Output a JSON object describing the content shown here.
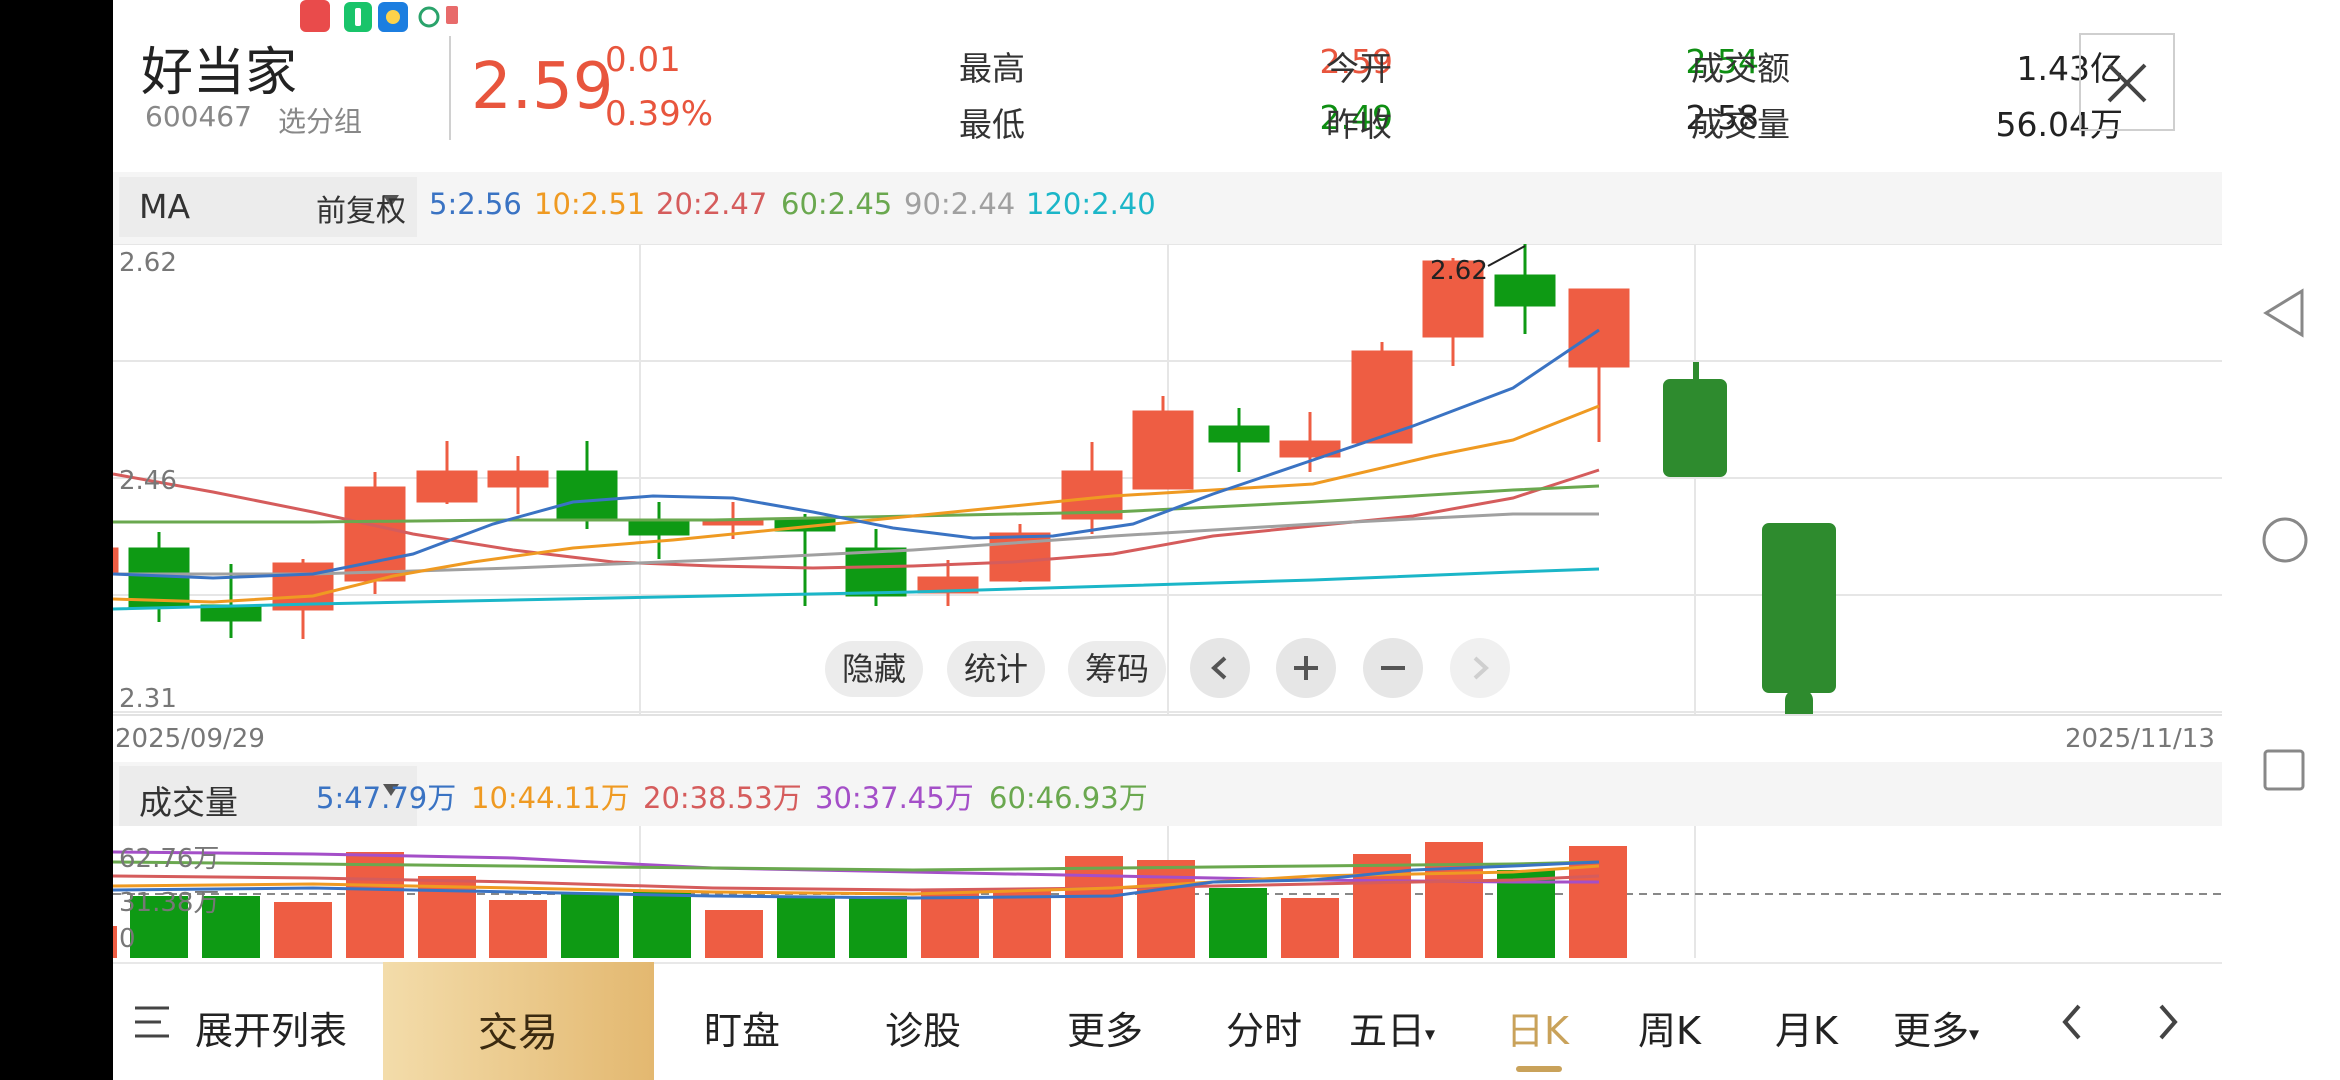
{
  "header": {
    "name": "好当家",
    "code": "600467",
    "group_btn": "选分组",
    "price": "2.59",
    "change": "0.01",
    "change_pct": "0.39%",
    "stats": [
      {
        "label": "最高",
        "value": "2.59",
        "color": "red"
      },
      {
        "label": "最低",
        "value": "2.49",
        "color": "green"
      },
      {
        "label": "今开",
        "value": "2.54",
        "color": "green"
      },
      {
        "label": "昨收",
        "value": "2.58",
        "color": "dark"
      },
      {
        "label": "成交额",
        "value": "1.43亿",
        "color": "dark"
      },
      {
        "label": "成交量",
        "value": "56.04万",
        "color": "dark"
      }
    ]
  },
  "ma_bar": {
    "selector": "MA",
    "adjust": "前复权",
    "items": [
      {
        "label": "5:2.56",
        "color": "#3a73c3"
      },
      {
        "label": "10:2.51",
        "color": "#ef9a22"
      },
      {
        "label": "20:2.47",
        "color": "#d55c5c"
      },
      {
        "label": "60:2.45",
        "color": "#6aa84f"
      },
      {
        "label": "90:2.44",
        "color": "#a0a0a0"
      },
      {
        "label": "120:2.40",
        "color": "#1bb6c8"
      }
    ]
  },
  "price_chart": {
    "y_top": "2.62",
    "y_mid": "2.46",
    "y_bottom": "2.31",
    "date_start": "2025/09/29",
    "date_end": "2025/11/13",
    "high_label": "2.62"
  },
  "tools": {
    "hide": "隐藏",
    "stats": "统计",
    "chips": "筹码",
    "prev": "‹",
    "zoom_in": "+",
    "zoom_out": "−",
    "next": "›"
  },
  "vol_bar": {
    "selector": "成交量",
    "items": [
      {
        "label": "5:47.79万",
        "color": "#3a73c3"
      },
      {
        "label": "10:44.11万",
        "color": "#ef9a22"
      },
      {
        "label": "20:38.53万",
        "color": "#d55c5c"
      },
      {
        "label": "30:37.45万",
        "color": "#a44fc8"
      },
      {
        "label": "60:46.93万",
        "color": "#6aa84f"
      }
    ]
  },
  "vol_chart": {
    "y_top": "62.76万",
    "y_mid": "31.38万",
    "y_zero": "0"
  },
  "bottom_bar": {
    "expand": "展开列表",
    "trade": "交易",
    "watch": "盯盘",
    "diagnose": "诊股",
    "more": "更多",
    "intraday": "分时",
    "five_day": "五日",
    "daily": "日K",
    "weekly": "周K",
    "monthly": "月K",
    "more2": "更多"
  },
  "colors": {
    "up": "#ee5d43",
    "down": "#0e9a14",
    "accent": "#c9a25a"
  }
}
